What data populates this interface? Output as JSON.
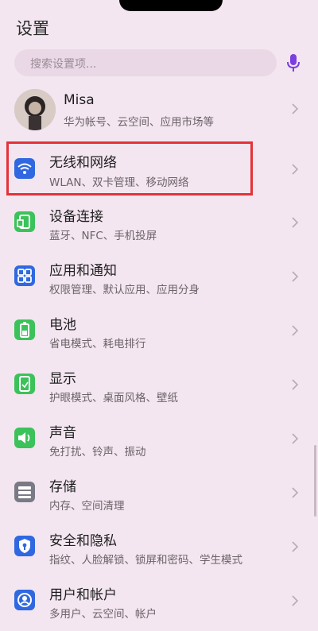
{
  "header": {
    "title": "设置"
  },
  "search": {
    "placeholder": "搜索设置项..."
  },
  "profile": {
    "name": "Misa",
    "subtitle": "华为帐号、云空间、应用市场等"
  },
  "items": [
    {
      "title": "无线和网络",
      "subtitle": "WLAN、双卡管理、移动网络",
      "icon": "wifi-icon",
      "color": "#2f68e0"
    },
    {
      "title": "设备连接",
      "subtitle": "蓝牙、NFC、手机投屏",
      "icon": "device-connection-icon",
      "color": "#3cc25a"
    },
    {
      "title": "应用和通知",
      "subtitle": "权限管理、默认应用、应用分身",
      "icon": "apps-icon",
      "color": "#2f68e0"
    },
    {
      "title": "电池",
      "subtitle": "省电模式、耗电排行",
      "icon": "battery-icon",
      "color": "#3cc25a"
    },
    {
      "title": "显示",
      "subtitle": "护眼模式、桌面风格、壁纸",
      "icon": "display-icon",
      "color": "#3cc25a"
    },
    {
      "title": "声音",
      "subtitle": "免打扰、铃声、振动",
      "icon": "sound-icon",
      "color": "#3cc25a"
    },
    {
      "title": "存储",
      "subtitle": "内存、空间清理",
      "icon": "storage-icon",
      "color": "#7a7a86"
    },
    {
      "title": "安全和隐私",
      "subtitle": "指纹、人脸解锁、锁屏和密码、学生模式",
      "icon": "shield-icon",
      "color": "#2f68e0"
    },
    {
      "title": "用户和帐户",
      "subtitle": "多用户、云空间、帐户",
      "icon": "user-icon",
      "color": "#2f68e0"
    }
  ]
}
